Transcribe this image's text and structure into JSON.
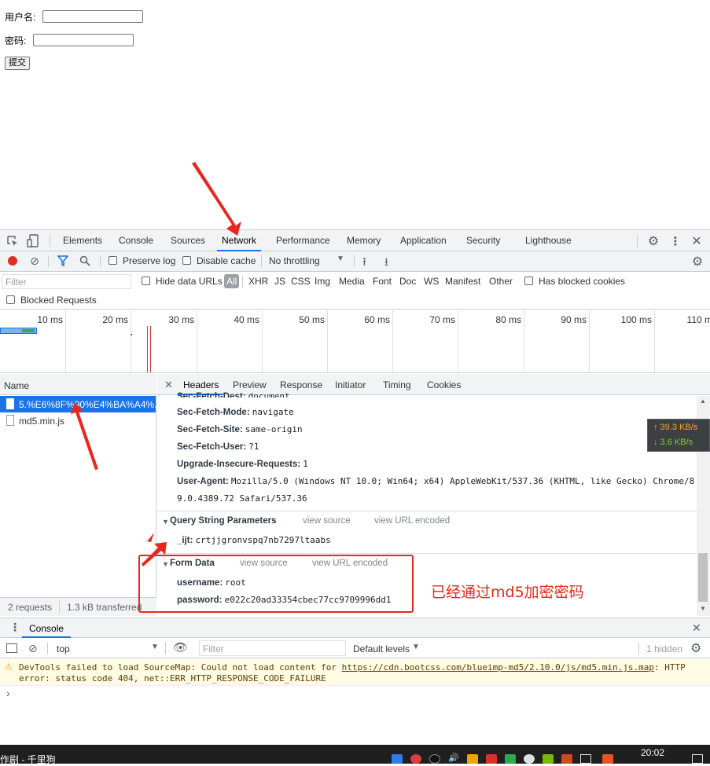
{
  "form": {
    "username_label": "用户名:",
    "password_label": "密码:",
    "submit_label": "提交"
  },
  "devtools": {
    "tabs": [
      "Elements",
      "Console",
      "Sources",
      "Network",
      "Performance",
      "Memory",
      "Application",
      "Security",
      "Lighthouse"
    ],
    "toolbar": {
      "preserve_log": "Preserve log",
      "disable_cache": "Disable cache",
      "throttling": "No throttling"
    },
    "filter": {
      "placeholder": "Filter",
      "hide_data_urls": "Hide data URLs",
      "all": "All",
      "types": [
        "XHR",
        "JS",
        "CSS",
        "Img",
        "Media",
        "Font",
        "Doc",
        "WS",
        "Manifest",
        "Other"
      ],
      "has_blocked_cookies": "Has blocked cookies",
      "blocked_requests": "Blocked Requests"
    },
    "timeline_ticks": [
      "10 ms",
      "20 ms",
      "30 ms",
      "40 ms",
      "50 ms",
      "60 ms",
      "70 ms",
      "80 ms",
      "90 ms",
      "100 ms",
      "110 ms"
    ],
    "name_header": "Name",
    "requests": [
      "5.%E6%8F%90%E4%BA%A4%...",
      "md5.min.js"
    ],
    "status_bar": {
      "requests": "2 requests",
      "transferred": "1.3 kB transferred"
    },
    "detail_tabs": [
      "Headers",
      "Preview",
      "Response",
      "Initiator",
      "Timing",
      "Cookies"
    ],
    "headers": [
      {
        "key": "Sec-Fetch-Dest:",
        "value": "document"
      },
      {
        "key": "Sec-Fetch-Mode:",
        "value": "navigate"
      },
      {
        "key": "Sec-Fetch-Site:",
        "value": "same-origin"
      },
      {
        "key": "Sec-Fetch-User:",
        "value": "?1"
      },
      {
        "key": "Upgrade-Insecure-Requests:",
        "value": "1"
      },
      {
        "key": "User-Agent:",
        "value": "Mozilla/5.0 (Windows NT 10.0; Win64; x64) AppleWebKit/537.36 (KHTML, like Gecko) Chrome/8"
      }
    ],
    "user_agent_cont": "9.0.4389.72 Safari/537.36",
    "query_section": {
      "title": "Query String Parameters",
      "view_source": "view source",
      "view_url_encoded": "view URL encoded",
      "params": [
        {
          "key": "_ijt:",
          "value": "crtjjgronvspq7nb7297ltaabs"
        }
      ]
    },
    "form_section": {
      "title": "Form Data",
      "view_source": "view source",
      "view_url_encoded": "view URL encoded",
      "params": [
        {
          "key": "username:",
          "value": "root"
        },
        {
          "key": "password:",
          "value": "e022c20ad33354cbec77cc9709996dd1"
        }
      ]
    },
    "speed": {
      "up": "↑ 39.3 KB/s",
      "down": "↓ 3.6 KB/s"
    },
    "console": {
      "title": "Console",
      "context": "top",
      "filter_placeholder": "Filter",
      "levels": "Default levels",
      "hidden": "1 hidden",
      "warning_prefix": "DevTools failed to load SourceMap: Could not load content for ",
      "warning_link": "https://cdn.bootcss.com/blueimp-md5/2.10.0/js/md5.min.js.map",
      "warning_suffix": ": HTTP",
      "warning_line2": "error: status code 404, net::ERR_HTTP_RESPONSE_CODE_FAILURE",
      "prompt": "›"
    }
  },
  "annotation": "已经通过md5加密密码",
  "taskbar": {
    "app": "作剧 - 千里狗",
    "time": "20:02"
  },
  "colors": {
    "accent": "#1a73e8",
    "annotation_red": "#e8281e",
    "selected_row": "#1a73e8",
    "warning_bg": "#fffbe5"
  }
}
